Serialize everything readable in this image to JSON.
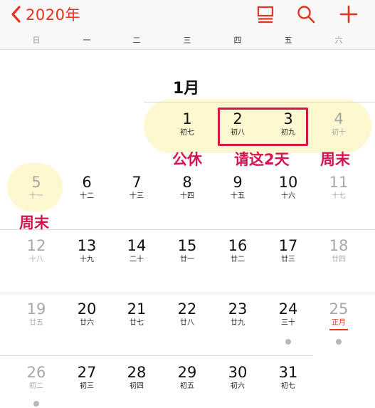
{
  "header": {
    "year_label": "2020年",
    "icons": [
      "back-chevron-icon",
      "list-view-icon",
      "search-icon",
      "add-icon"
    ],
    "accent_color": "#e8321e"
  },
  "weekdays": [
    "日",
    "一",
    "二",
    "三",
    "四",
    "五",
    "六"
  ],
  "month_title": "1月",
  "annotations": {
    "public_holiday": "公休",
    "take_leave": "请这2天",
    "weekend_a": "周末",
    "weekend_b": "周末",
    "annotation_color": "#d3164d"
  },
  "days": [
    {
      "num": "1",
      "lunar": "初七"
    },
    {
      "num": "2",
      "lunar": "初八"
    },
    {
      "num": "3",
      "lunar": "初九"
    },
    {
      "num": "4",
      "lunar": "初十"
    },
    {
      "num": "5",
      "lunar": "十一"
    },
    {
      "num": "6",
      "lunar": "十二"
    },
    {
      "num": "7",
      "lunar": "十三"
    },
    {
      "num": "8",
      "lunar": "十四"
    },
    {
      "num": "9",
      "lunar": "十五"
    },
    {
      "num": "10",
      "lunar": "十六"
    },
    {
      "num": "11",
      "lunar": "十七"
    },
    {
      "num": "12",
      "lunar": "十八"
    },
    {
      "num": "13",
      "lunar": "十九"
    },
    {
      "num": "14",
      "lunar": "二十"
    },
    {
      "num": "15",
      "lunar": "廿一"
    },
    {
      "num": "16",
      "lunar": "廿二"
    },
    {
      "num": "17",
      "lunar": "廿三"
    },
    {
      "num": "18",
      "lunar": "廿四"
    },
    {
      "num": "19",
      "lunar": "廿五"
    },
    {
      "num": "20",
      "lunar": "廿六"
    },
    {
      "num": "21",
      "lunar": "廿七"
    },
    {
      "num": "22",
      "lunar": "廿八"
    },
    {
      "num": "23",
      "lunar": "廿九"
    },
    {
      "num": "24",
      "lunar": "三十"
    },
    {
      "num": "25",
      "lunar": "正月"
    },
    {
      "num": "26",
      "lunar": "初二"
    },
    {
      "num": "27",
      "lunar": "初三"
    },
    {
      "num": "28",
      "lunar": "初四"
    },
    {
      "num": "29",
      "lunar": "初五"
    },
    {
      "num": "30",
      "lunar": "初六"
    },
    {
      "num": "31",
      "lunar": "初七"
    }
  ],
  "event_dot_days": [
    "24",
    "25",
    "26"
  ]
}
